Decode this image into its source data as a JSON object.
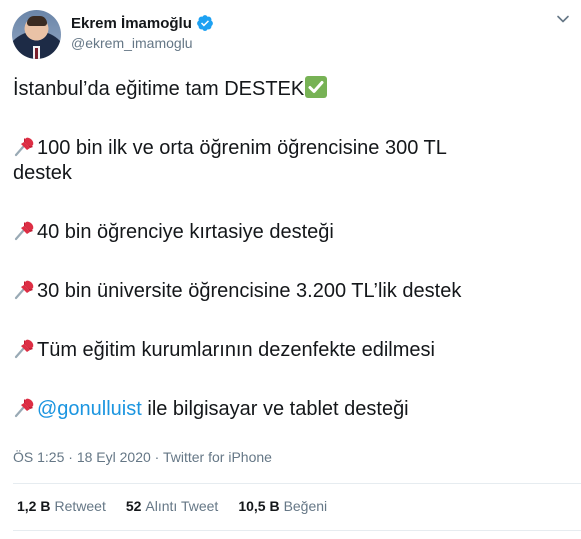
{
  "user": {
    "name": "Ekrem İmamoğlu",
    "handle": "@ekrem_imamoglu",
    "verified_color": "#1da1f2"
  },
  "tweet": {
    "headline": "İstanbul’da eğitime tam DESTEK",
    "items": [
      {
        "text_l1": "100 bin ilk ve orta öğrenim öğrencisine 300 TL",
        "text_l2": "destek"
      },
      {
        "text": "40 bin öğrenciye kırtasiye desteği"
      },
      {
        "text": "30 bin üniversite öğrencisine 3.200 TL’lik destek"
      },
      {
        "text": "Tüm eğitim kurumlarının dezenfekte edilmesi"
      },
      {
        "mention": "@gonulluist",
        "text": " ile bilgisayar ve tablet desteği"
      }
    ],
    "icons": [
      "check-mark-emoji",
      "pushpin-emoji"
    ]
  },
  "meta": {
    "time": "ÖS 1:25",
    "separator": " · ",
    "date": "18 Eyl 2020",
    "source": "Twitter for iPhone"
  },
  "stats": {
    "retweet_count": "1,2 B",
    "retweet_label": "Retweet",
    "quote_count": "52",
    "quote_label": "Alıntı Tweet",
    "like_count": "10,5 B",
    "like_label": "Beğeni"
  },
  "colors": {
    "text": "#14171a",
    "secondary": "#657786",
    "link": "#1b95e0",
    "divider": "#e6ecf0"
  }
}
